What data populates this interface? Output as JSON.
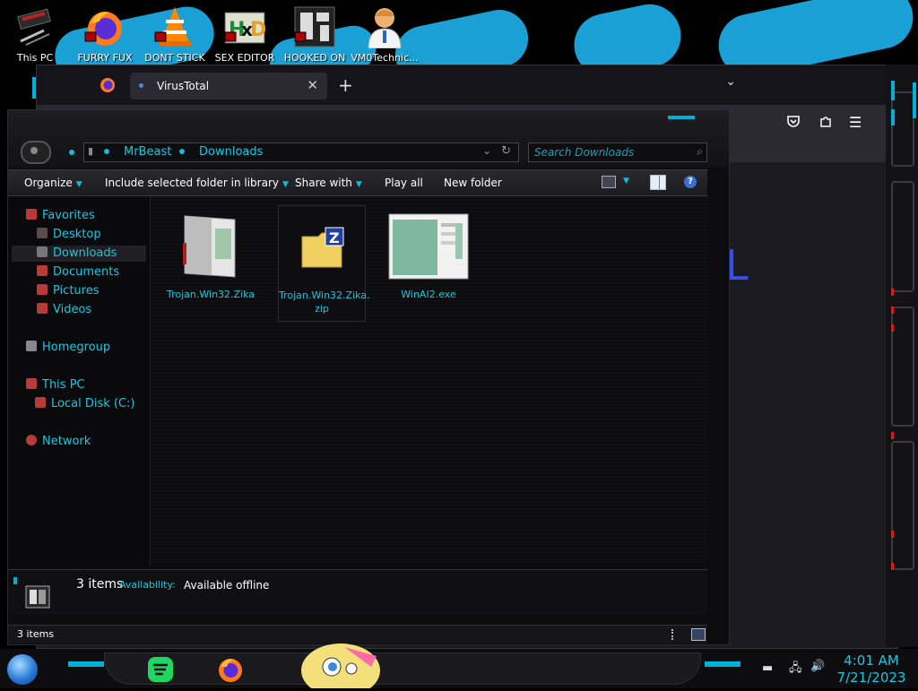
{
  "desktop": {
    "icons": [
      {
        "label": "This PC",
        "icon": "computer-icon"
      },
      {
        "label": "FURRY FUX",
        "icon": "firefox-icon"
      },
      {
        "label": "DONT STICK",
        "icon": "vlc-icon"
      },
      {
        "label": "SEX EDITOR",
        "icon": "hxd-icon"
      },
      {
        "label": "HOOKED ON",
        "icon": "app-icon"
      },
      {
        "label": "VM0Technic...",
        "icon": "doctor-icon"
      }
    ]
  },
  "browser": {
    "tab_title": "VirusTotal",
    "partial_logo_text": "L",
    "colors": {
      "logo": "#3950e8",
      "toolbar": "#2b2a33"
    }
  },
  "explorer": {
    "breadcrumb": [
      "MrBeast",
      "Downloads"
    ],
    "search_placeholder": "Search Downloads",
    "commands": {
      "organize": "Organize",
      "include": "Include selected folder in library",
      "share": "Share with",
      "play": "Play all",
      "new_folder": "New folder",
      "help": "?"
    },
    "nav": {
      "favorites": "Favorites",
      "desktop": "Desktop",
      "downloads": "Downloads",
      "documents": "Documents",
      "pictures": "Pictures",
      "videos": "Videos",
      "homegroup": "Homegroup",
      "this_pc": "This PC",
      "local_disk": "Local Disk (C:)",
      "network": "Network"
    },
    "files": [
      {
        "name": "Trojan.Win32.Zika",
        "type": "application"
      },
      {
        "name": "Trojan.Win32.Zika.zip",
        "name_line1": "Trojan.Win32.Zika.",
        "name_line2": "zip",
        "type": "archive"
      },
      {
        "name": "WinAI2.exe",
        "type": "executable"
      }
    ],
    "details": {
      "count": "3 items",
      "availability_label": "Availability:",
      "availability_value": "Available offline"
    },
    "status": "3 items",
    "accent": "#18c8e0"
  },
  "taskbar": {
    "clock_time": "4:01 AM",
    "clock_date": "7/21/2023",
    "apps": [
      "spotify-icon",
      "firefox-icon"
    ]
  }
}
